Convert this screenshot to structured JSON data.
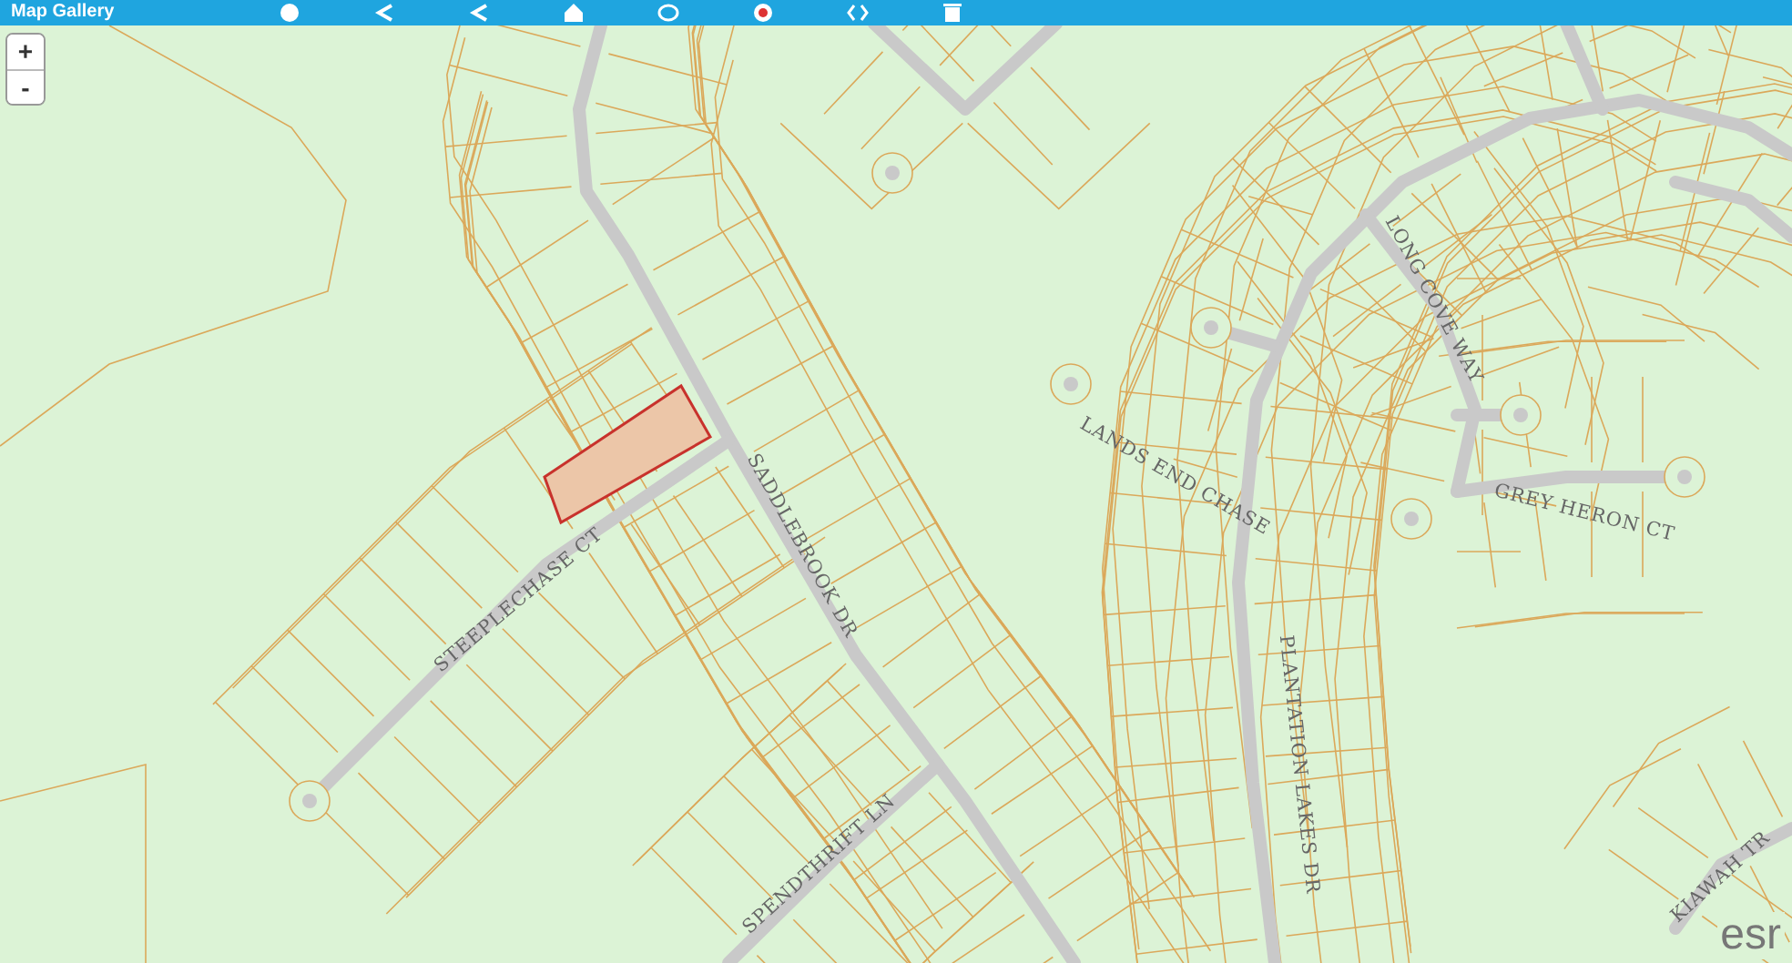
{
  "toolbar": {
    "title": "Map Gallery"
  },
  "zoom_controls": [
    {
      "label": "+"
    },
    {
      "label": "-"
    }
  ],
  "map": {
    "street_labels": [
      {
        "text": "STEEPLECHASE CT"
      },
      {
        "text": "SADDLEBROOK DR"
      },
      {
        "text": "SPENDTHRIFT LN"
      },
      {
        "text": "PLANTATION LAKES DR"
      },
      {
        "text": "LANDS END CHASE"
      },
      {
        "text": "LONG COVE WAY"
      },
      {
        "text": "GREY HERON CT"
      },
      {
        "text": "KIAWAH TR"
      }
    ]
  },
  "attribution": {
    "logo": "esr"
  }
}
